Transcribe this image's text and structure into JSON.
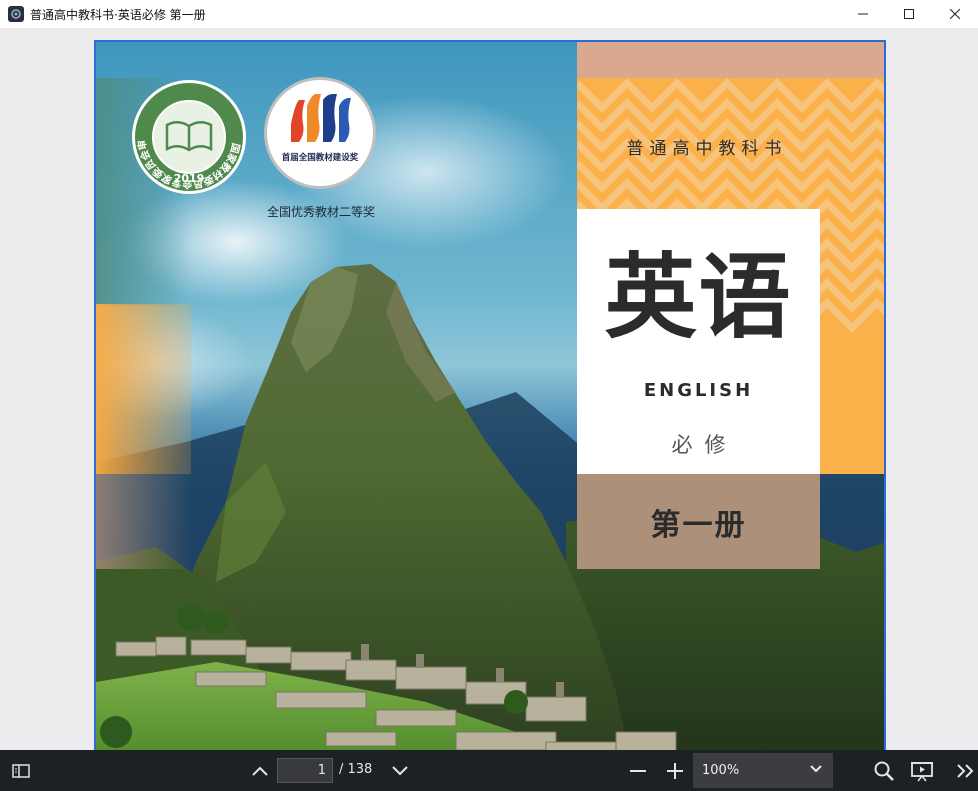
{
  "window": {
    "title": "普通高中教科书·英语必修 第一册",
    "controls": [
      "minimize",
      "maximize",
      "close"
    ]
  },
  "cover": {
    "series_title": "普通高中教科书",
    "book_title": "英语",
    "english_title": "ENGLISH",
    "course_type": "必修",
    "volume": "第一册",
    "badge_green": {
      "ring_text": "国家教材委员会专家委员会审核通过",
      "year": "2019"
    },
    "badge_red": {
      "ring_text": "首届全国教材建设奖"
    },
    "award_caption": "全国优秀教材二等奖",
    "colors": {
      "orange": "#fbb04a",
      "brown": "#ac907a",
      "teal": "#4d8c82",
      "badge_green": "#4f8a4c",
      "page_border": "#2f6bd8"
    }
  },
  "toolbar": {
    "current_page": "1",
    "page_total": "/ 138",
    "zoom": "100%",
    "icons": [
      "sidebar-toggle-icon",
      "prev-page-icon",
      "next-page-icon",
      "zoom-out-icon",
      "zoom-in-icon",
      "search-icon",
      "presentation-icon",
      "more-icon"
    ]
  }
}
